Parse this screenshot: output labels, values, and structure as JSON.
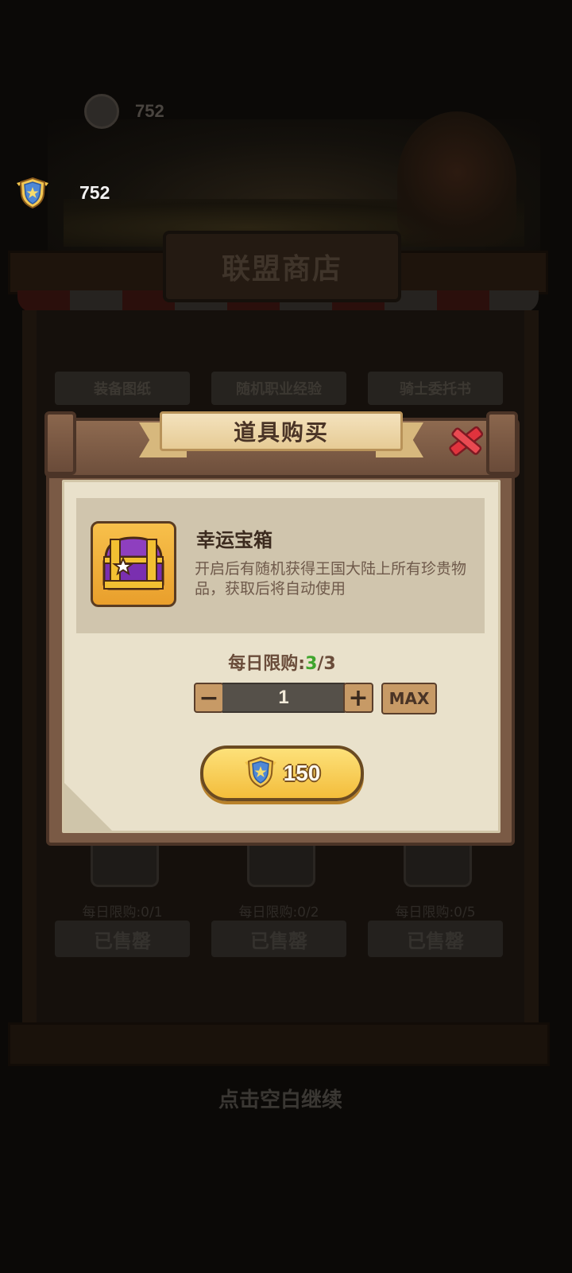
{
  "currency": {
    "value": "752",
    "icon": "shield-badge-icon"
  },
  "background": {
    "currency_value": "752",
    "shop_title": "联盟商店",
    "tabs": [
      "装备图纸",
      "随机职业经验",
      "骑士委托书"
    ],
    "cards": [
      {
        "limit": "每日限购:0/1",
        "status": "已售罄"
      },
      {
        "limit": "每日限购:0/2",
        "status": "已售罄"
      },
      {
        "limit": "每日限购:0/5",
        "status": "已售罄"
      }
    ],
    "tap_hint": "点击空白继续"
  },
  "dialog": {
    "title": "道具购买",
    "item": {
      "name": "幸运宝箱",
      "description": "开启后有随机获得王国大陆上所有珍贵物品，获取后将自动使用",
      "icon": "treasure-chest-icon"
    },
    "daily_limit": {
      "label": "每日限购:",
      "current": "3",
      "separator": "/",
      "max": "3"
    },
    "quantity": "1",
    "minus_label": "−",
    "plus_label": "+",
    "max_label": "MAX",
    "price": "150"
  }
}
